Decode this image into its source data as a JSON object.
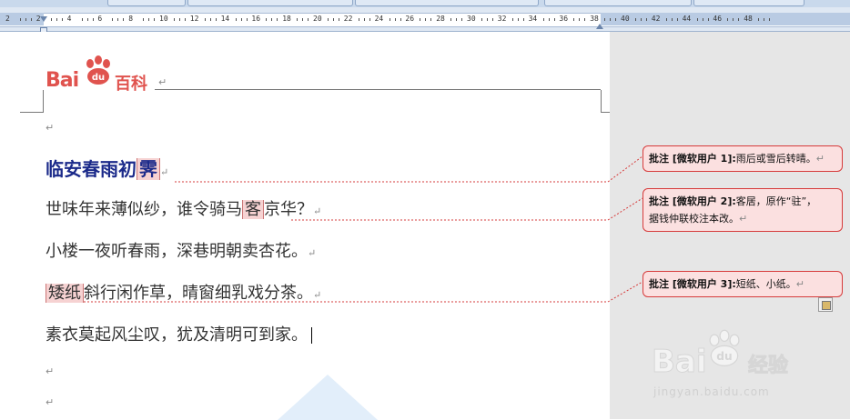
{
  "ruler": {
    "labels": [
      "2",
      "2",
      "4",
      "6",
      "8",
      "10",
      "12",
      "14",
      "16",
      "18",
      "20",
      "22",
      "24",
      "26",
      "28",
      "30",
      "32",
      "34",
      "36",
      "38",
      "40",
      "42",
      "44",
      "46",
      "48"
    ]
  },
  "logo": {
    "brand": "Bai",
    "paw_text": "du",
    "suffix": "百科"
  },
  "document": {
    "paragraph_mark": "↵",
    "title": {
      "before": "临安春雨初",
      "highlight": "霁"
    },
    "lines": [
      {
        "before": "世味年来薄似纱，谁令骑马",
        "highlight": "客",
        "after": "京华？"
      },
      {
        "text": "小楼一夜听春雨，深巷明朝卖杏花。"
      },
      {
        "highlight": "矮纸",
        "after": "斜行闲作草，晴窗细乳戏分茶。"
      },
      {
        "text": "素衣莫起风尘叹，犹及清明可到家。"
      }
    ]
  },
  "comments": [
    {
      "label": "批注 [微软用户 1]:",
      "text": "雨后或雪后转晴。"
    },
    {
      "label": "批注 [微软用户 2]:",
      "text": "客居，原作“驻”，",
      "text2": "据钱仲联校注本改。"
    },
    {
      "label": "批注 [微软用户 3]:",
      "text": "短纸、小纸。"
    }
  ],
  "watermark": {
    "brand": "Bai",
    "paw_text": "du",
    "cn": "经验",
    "url": "jingyan.baidu.com"
  },
  "colors": {
    "comment_bg": "#fbe0e0",
    "comment_border": "#d63b3b",
    "title": "#1b2a8a",
    "highlight": "#f6d2d2"
  }
}
